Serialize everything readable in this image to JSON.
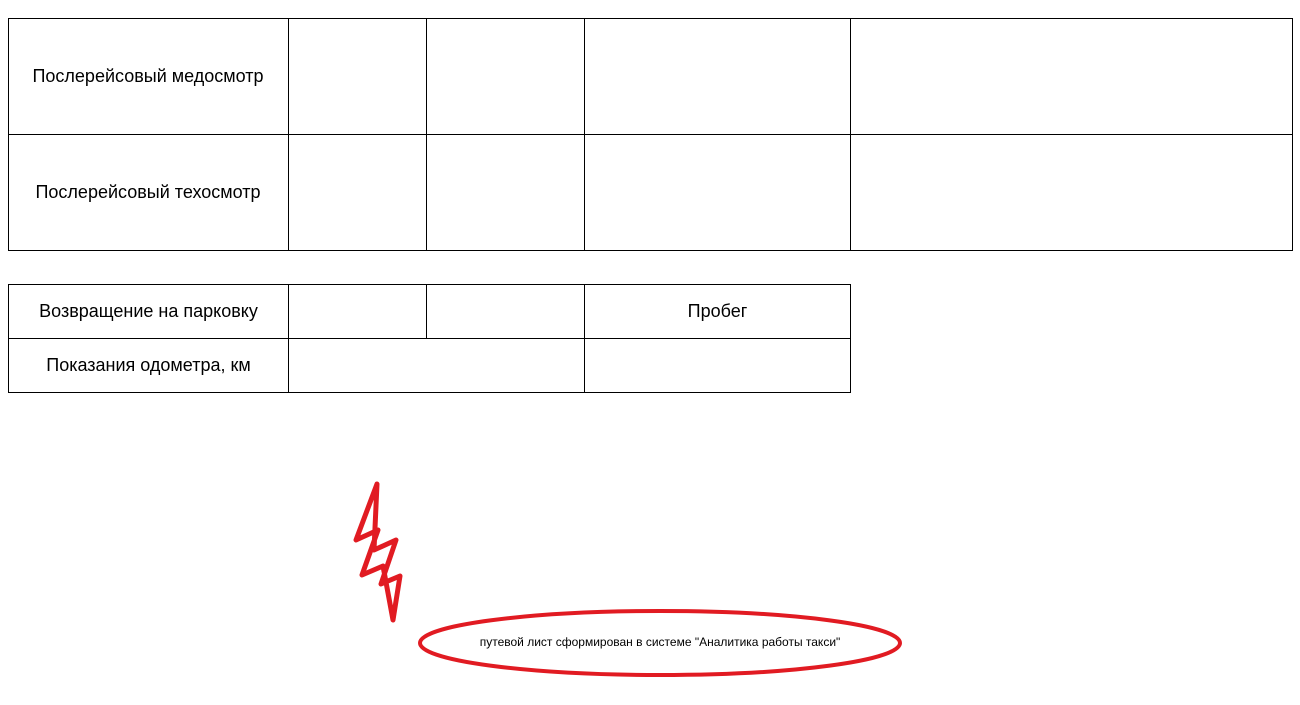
{
  "table1": {
    "rows": [
      {
        "label": "Послерейсовый медосмотр",
        "c2": "",
        "c3": "",
        "c4": "",
        "c5": ""
      },
      {
        "label": "Послерейсовый техосмотр",
        "c2": "",
        "c3": "",
        "c4": "",
        "c5": ""
      }
    ]
  },
  "table2": {
    "row1": {
      "label": "Возвращение на парковку",
      "c2": "",
      "c3": "",
      "c4": "Пробег"
    },
    "row2": {
      "label": "Показания одометра, км",
      "c23": "",
      "c4": ""
    }
  },
  "footnote": "путевой лист сформирован в системе \"Аналитика работы такси\"",
  "annotation": {
    "color": "#e11b22"
  }
}
